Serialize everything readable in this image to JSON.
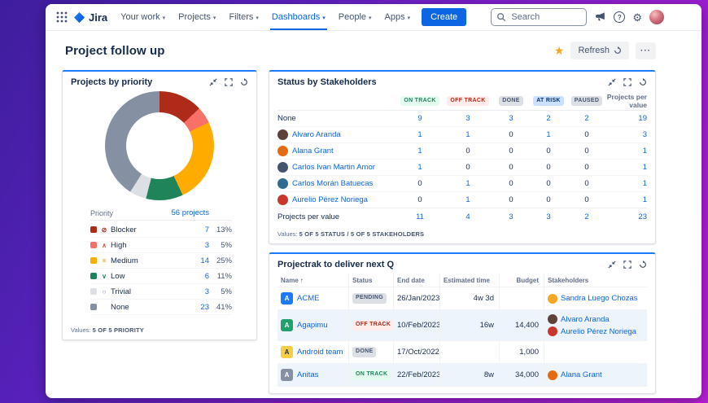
{
  "nav": {
    "app_name": "Jira",
    "items": [
      {
        "label": "Your work",
        "active": false
      },
      {
        "label": "Projects",
        "active": false
      },
      {
        "label": "Filters",
        "active": false
      },
      {
        "label": "Dashboards",
        "active": true
      },
      {
        "label": "People",
        "active": false
      },
      {
        "label": "Apps",
        "active": false
      }
    ],
    "create_label": "Create",
    "search_placeholder": "Search"
  },
  "header": {
    "title": "Project follow up",
    "refresh_label": "Refresh"
  },
  "icons": {
    "chevron_glyph": "▾",
    "star_glyph": "★",
    "more_glyph": "···",
    "help_glyph": "?",
    "gear_glyph": "⚙",
    "sort_asc_glyph": "↑"
  },
  "priority_panel": {
    "title": "Projects by priority",
    "legend_label": "Priority",
    "total_link": "56 projects",
    "rows": [
      {
        "label": "Blocker",
        "count": "7",
        "percent": "13%",
        "swatch": "#AE2A19",
        "glyph": "⊘",
        "glyph_color": "#AE2A19"
      },
      {
        "label": "High",
        "count": "3",
        "percent": "5%",
        "swatch": "#F87168",
        "glyph": "∧",
        "glyph_color": "#E2483D"
      },
      {
        "label": "Medium",
        "count": "14",
        "percent": "25%",
        "swatch": "#FFAB00",
        "glyph": "=",
        "glyph_color": "#E2940A"
      },
      {
        "label": "Low",
        "count": "6",
        "percent": "11%",
        "swatch": "#1F845A",
        "glyph": "∨",
        "glyph_color": "#1F845A"
      },
      {
        "label": "Trivial",
        "count": "3",
        "percent": "5%",
        "swatch": "#DCDFE4",
        "glyph": "○",
        "glyph_color": "#758195"
      },
      {
        "label": "None",
        "count": "23",
        "percent": "41%",
        "swatch": "#8590A2",
        "glyph": "",
        "glyph_color": "#8590A2"
      }
    ],
    "footer_label": "Values:",
    "footer_value": "5 OF 5 PRIORITY"
  },
  "chart_data": {
    "type": "pie",
    "title": "Projects by priority",
    "donut": true,
    "total": 56,
    "total_label": "56 projects",
    "categories": [
      "Blocker",
      "High",
      "Medium",
      "Low",
      "Trivial",
      "None"
    ],
    "values": [
      7,
      3,
      14,
      6,
      3,
      23
    ],
    "percents": [
      13,
      5,
      25,
      11,
      5,
      41
    ],
    "colors": [
      "#AE2A19",
      "#F87168",
      "#FFAB00",
      "#1F845A",
      "#DCDFE4",
      "#8590A2"
    ],
    "legend_position": "bottom"
  },
  "status_panel": {
    "title": "Status by Stakeholders",
    "columns": [
      {
        "label": "ON TRACK",
        "style": "green"
      },
      {
        "label": "OFF TRACK",
        "style": "red"
      },
      {
        "label": "DONE",
        "style": "gray"
      },
      {
        "label": "AT RISK",
        "style": "blue"
      },
      {
        "label": "PAUSED",
        "style": "gray"
      },
      {
        "label": "Projects per value"
      }
    ],
    "rows": [
      {
        "name": "None",
        "values": [
          "9",
          "3",
          "3",
          "2",
          "2"
        ],
        "total": "19"
      },
      {
        "name": "Alvaro Aranda",
        "avatar_color": "#5E4238",
        "values": [
          "1",
          "1",
          "0",
          "1",
          "0"
        ],
        "total": "3"
      },
      {
        "name": "Alana Grant",
        "avatar_color": "#E56910",
        "values": [
          "1",
          "0",
          "0",
          "0",
          "0"
        ],
        "total": "1"
      },
      {
        "name": "Carlos Ivan Martin Amor",
        "avatar_color": "#44546F",
        "values": [
          "1",
          "0",
          "0",
          "0",
          "0"
        ],
        "total": "1"
      },
      {
        "name": "Carlos Morán Batuecas",
        "avatar_color": "#2E6B8F",
        "values": [
          "0",
          "1",
          "0",
          "0",
          "0"
        ],
        "total": "1"
      },
      {
        "name": "Aurelio Pérez Noriega",
        "avatar_color": "#C9372C",
        "values": [
          "0",
          "1",
          "0",
          "0",
          "0"
        ],
        "total": "1"
      }
    ],
    "totals": {
      "label": "Projects per value",
      "values": [
        "11",
        "4",
        "3",
        "3",
        "2"
      ],
      "total": "23"
    },
    "footer_label": "Values:",
    "footer_value": "5 OF 5 STATUS / 5 OF 5 STAKEHOLDERS"
  },
  "deliver_panel": {
    "title": "Projectrak to deliver next Q",
    "columns": [
      {
        "label": "Name",
        "sorted": true
      },
      {
        "label": "Status"
      },
      {
        "label": "End date"
      },
      {
        "label": "Estimated time"
      },
      {
        "label": "Budget"
      },
      {
        "label": "Stakeholders"
      }
    ],
    "rows": [
      {
        "name": "ACME",
        "icon_bg": "#1D7AFC",
        "icon_fg": "#FFFFFF",
        "icon_glyph": "A",
        "status": "PENDING",
        "status_style": "gray",
        "end_date": "26/Jan/2023",
        "estimated": "4w 3d",
        "budget": "",
        "stakeholders": [
          {
            "name": "Sandra Luego Chozas",
            "color": "#F5A623"
          }
        ]
      },
      {
        "name": "Agapimu",
        "icon_bg": "#22A06B",
        "icon_fg": "#FFFFFF",
        "icon_glyph": "A",
        "status": "OFF TRACK",
        "status_style": "red",
        "end_date": "10/Feb/2023",
        "estimated": "16w",
        "budget": "14,400",
        "stakeholders": [
          {
            "name": "Alvaro Aranda",
            "color": "#5E4238"
          },
          {
            "name": "Aurelio Pérez Noriega",
            "color": "#C9372C"
          }
        ]
      },
      {
        "name": "Android team",
        "icon_bg": "#F5CD47",
        "icon_fg": "#172B4D",
        "icon_glyph": "A",
        "status": "DONE",
        "status_style": "gray",
        "end_date": "17/Oct/2022",
        "estimated": "",
        "budget": "1,000",
        "stakeholders": []
      },
      {
        "name": "Anitas",
        "icon_bg": "#8590A2",
        "icon_fg": "#FFFFFF",
        "icon_glyph": "A",
        "status": "ON TRACK",
        "status_style": "green",
        "end_date": "22/Feb/2023",
        "estimated": "8w",
        "budget": "34,000",
        "stakeholders": [
          {
            "name": "Alana Grant",
            "color": "#E56910"
          }
        ]
      }
    ]
  }
}
